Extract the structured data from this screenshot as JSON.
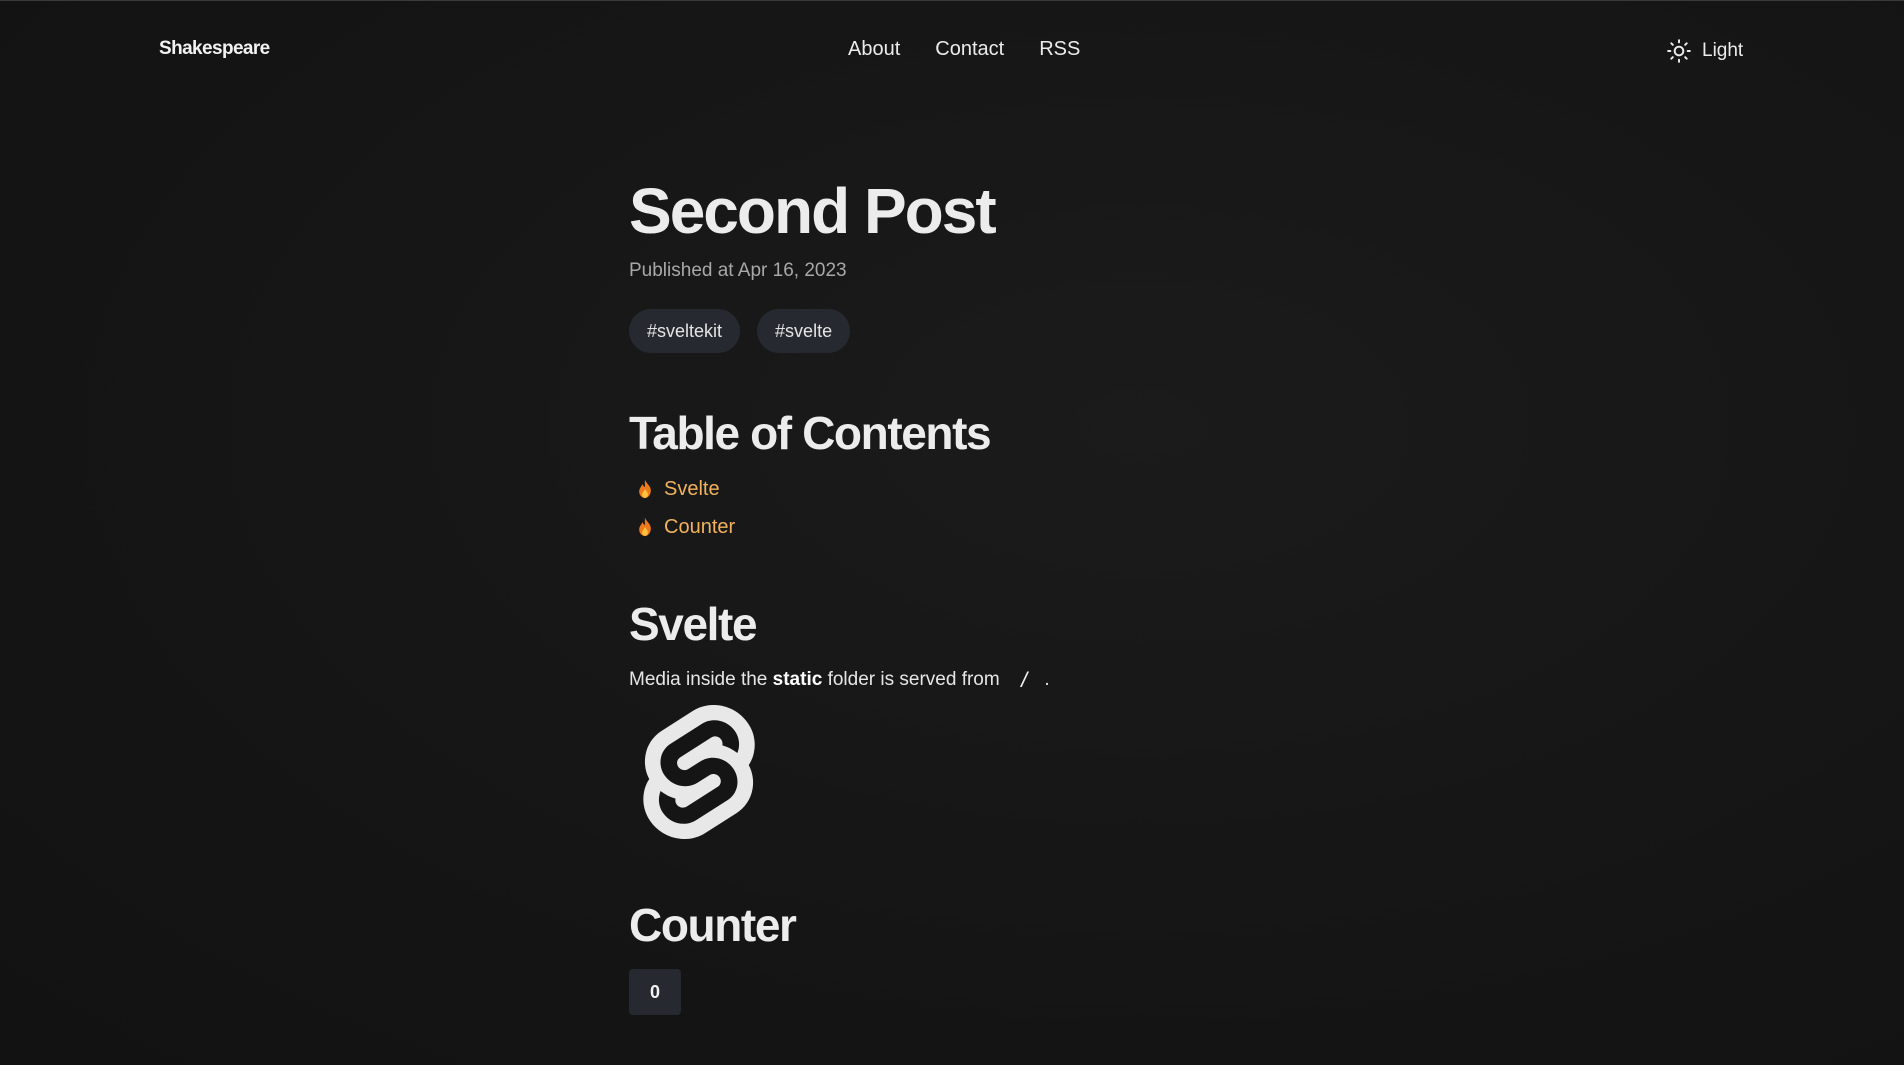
{
  "header": {
    "brand": "Shakespeare",
    "nav": [
      "About",
      "Contact",
      "RSS"
    ],
    "theme_label": "Light",
    "theme_icon": "sun-icon"
  },
  "post": {
    "title": "Second Post",
    "published": "Published at Apr 16, 2023",
    "tags": [
      "#sveltekit",
      "#svelte"
    ]
  },
  "toc": {
    "title": "Table of Contents",
    "icon": "flame-icon",
    "items": [
      "Svelte",
      "Counter"
    ]
  },
  "svelte_section": {
    "title": "Svelte",
    "text_before": "Media inside the ",
    "bold": "static",
    "text_after": " folder is served from ",
    "code": "/",
    "period": ".",
    "logo": "svelte-logo"
  },
  "counter_section": {
    "title": "Counter",
    "count": "0"
  },
  "colors": {
    "background": "#151515",
    "text": "#ececec",
    "muted": "#a8a8a8",
    "link_accent": "#f2b25c",
    "chip_bg": "#262a30"
  }
}
